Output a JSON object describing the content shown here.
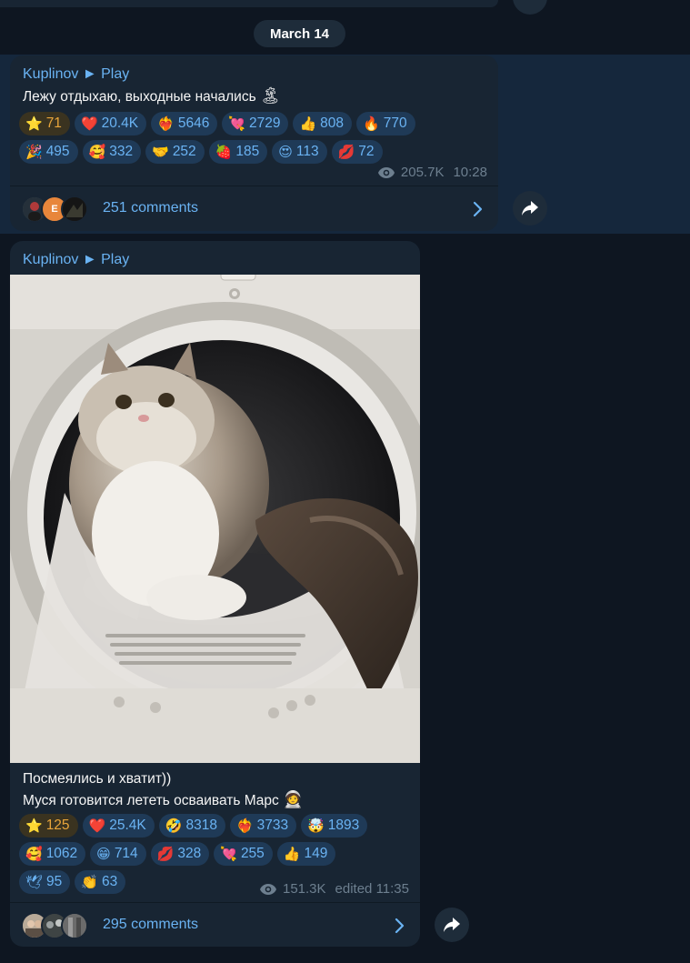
{
  "date_label": "March 14",
  "colors": {
    "background": "#0e1621",
    "bubble": "#182533",
    "highlight": "#15273c",
    "accent": "#6ab3f3",
    "paid_star": "#e8a53b",
    "meta_text": "#6d7f8f"
  },
  "posts": [
    {
      "channel": "Kuplinov ► Play",
      "text_lines": [
        "Лежу отдыхаю, выходные начались"
      ],
      "text_emoji": "🏝",
      "reaction_rows": [
        [
          {
            "emoji": "⭐",
            "count": "71",
            "paid": true
          },
          {
            "emoji": "❤️",
            "count": "20.4K"
          },
          {
            "emoji": "❤️‍🔥",
            "count": "5646"
          },
          {
            "emoji": "💘",
            "count": "2729"
          },
          {
            "emoji": "👍",
            "count": "808"
          },
          {
            "emoji": "🔥",
            "count": "770"
          }
        ],
        [
          {
            "emoji": "🎉",
            "count": "495"
          },
          {
            "emoji": "🥰",
            "count": "332"
          },
          {
            "emoji": "🤝",
            "count": "252"
          },
          {
            "emoji": "🍓",
            "count": "185"
          },
          {
            "emoji": "😍",
            "count": "113"
          },
          {
            "emoji": "💋",
            "count": "72"
          }
        ]
      ],
      "views": "205.7K",
      "time": "10:28",
      "comments": "251 comments",
      "commenter_initial": "E",
      "icons": {
        "views": "eye-icon",
        "open_comments": "chevron-right-icon",
        "share": "share-arrow-icon"
      }
    },
    {
      "channel": "Kuplinov ► Play",
      "text_lines": [
        "Посмеялись и хватит))",
        "Муся готовится лететь осваивать Марс"
      ],
      "text_emoji": "🧑‍🚀",
      "reaction_rows": [
        [
          {
            "emoji": "⭐",
            "count": "125",
            "paid": true
          },
          {
            "emoji": "❤️",
            "count": "25.4K"
          },
          {
            "emoji": "🤣",
            "count": "8318"
          },
          {
            "emoji": "❤️‍🔥",
            "count": "3733"
          },
          {
            "emoji": "🤯",
            "count": "1893"
          }
        ],
        [
          {
            "emoji": "🥰",
            "count": "1062"
          },
          {
            "emoji": "😁",
            "count": "714"
          },
          {
            "emoji": "💋",
            "count": "328"
          },
          {
            "emoji": "💘",
            "count": "255"
          },
          {
            "emoji": "👍",
            "count": "149"
          }
        ],
        [
          {
            "emoji": "🕊",
            "count": "95"
          },
          {
            "emoji": "👏",
            "count": "63"
          }
        ]
      ],
      "views": "151.3K",
      "time": "edited 11:35",
      "comments": "295 comments",
      "photo": "cat-in-dryer-photo",
      "icons": {
        "views": "eye-icon",
        "open_comments": "chevron-right-icon",
        "share": "share-arrow-icon"
      }
    }
  ]
}
